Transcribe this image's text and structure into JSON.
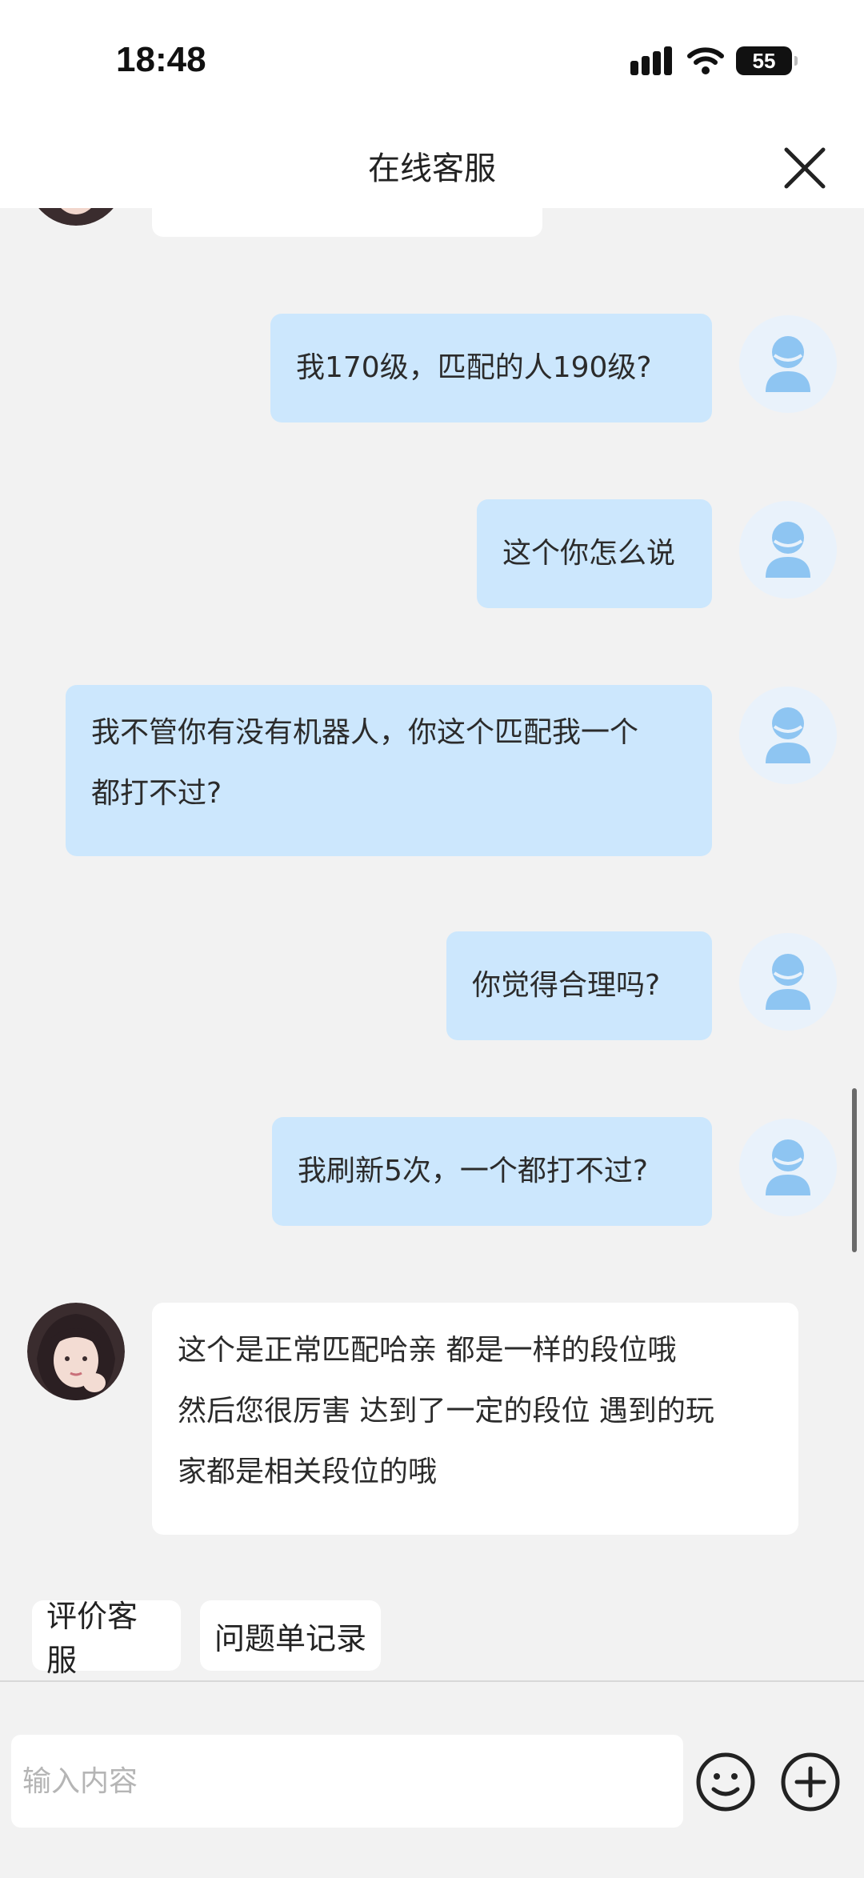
{
  "status": {
    "time": "18:48",
    "battery": "55"
  },
  "header": {
    "title": "在线客服"
  },
  "messages": {
    "user1": "我170级，匹配的人190级?",
    "user2": "这个你怎么说",
    "user3_line1": "我不管你有没有机器人，你这个匹配我一个",
    "user3_line2": "都打不过?",
    "user4": "你觉得合理吗?",
    "user5": "我刷新5次，一个都打不过?",
    "agent_line1": "这个是正常匹配哈亲 都是一样的段位哦",
    "agent_line2": "然后您很厉害 达到了一定的段位 遇到的玩",
    "agent_line3": "家都是相关段位的哦"
  },
  "quick_actions": {
    "rate": "评价客服",
    "tickets": "问题单记录"
  },
  "input": {
    "placeholder": "输入内容"
  },
  "icons": {
    "close": "close-icon",
    "emoji": "smiley-icon",
    "plus": "plus-circle-icon",
    "signal": "signal-icon",
    "wifi": "wifi-icon",
    "user": "user-avatar-icon"
  },
  "colors": {
    "user_bubble": "#cce7fd",
    "agent_bubble": "#ffffff",
    "background": "#f2f2f2"
  }
}
